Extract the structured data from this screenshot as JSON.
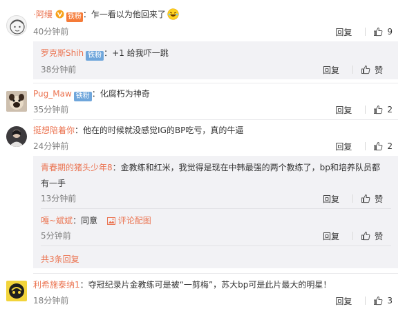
{
  "labels": {
    "reply": "回复",
    "zan": "赞",
    "fans_badge": "铁粉",
    "colon": "："
  },
  "comments": [
    {
      "user": "·阿缦",
      "text": "乍一看以为他回来了",
      "time": "40分钟前",
      "likes": "9",
      "sub": [
        {
          "user": "罗克斯Shih",
          "text": "+1 给我吓一跳",
          "time": "38分钟前"
        }
      ]
    },
    {
      "user": "Pug_Maw",
      "text": "化腐朽为神奇",
      "time": "35分钟前",
      "likes": "2"
    },
    {
      "user": "挺想陪着你",
      "text": "他在的时候就没感觉IG的BP吃亏，真的牛逼",
      "time": "24分钟前",
      "likes": "2",
      "sub": [
        {
          "user": "青春期的猪头少年8",
          "text": "金教练和红米，我觉得是现在中韩最强的两个教练了，bp和培养队员都",
          "text2": "有一手",
          "time": "13分钟前"
        },
        {
          "user": "嘎~斌斌",
          "text": "同意",
          "pic_label": "评论配图",
          "time": "5分钟前"
        }
      ],
      "more": "共3条回复"
    },
    {
      "user": "利希施泰纳1",
      "text": "夺冠纪录片金教练可是被“一剪梅”，苏大bp可是此片最大的明星！",
      "time": "18分钟前",
      "likes": "3"
    }
  ],
  "colors": {
    "username": "#eb7350",
    "text": "#333333",
    "time": "#808080",
    "fans_badge": "#6fa6db",
    "sub_bg": "#f2f2f5"
  },
  "icons": [
    "thumbs-up-icon",
    "verified-v-icon",
    "fans-badge",
    "laughing-emoji-icon",
    "picture-icon"
  ]
}
